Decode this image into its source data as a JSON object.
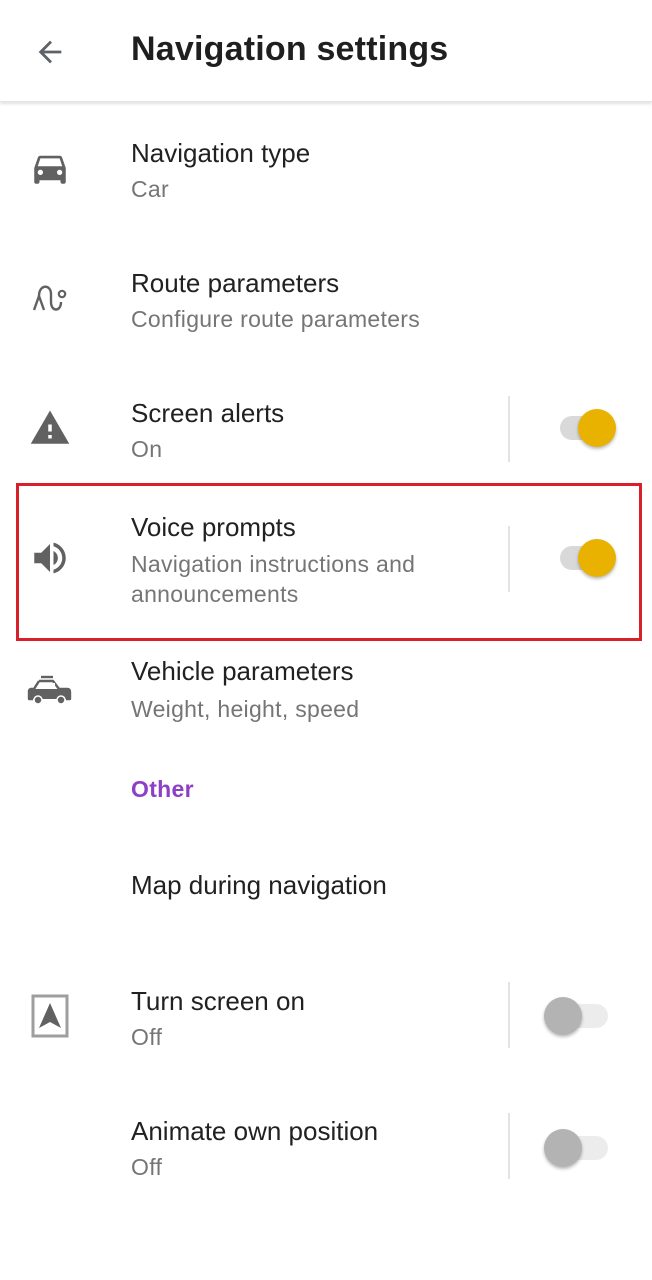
{
  "appbar": {
    "title": "Navigation settings",
    "back_icon": "arrow-back-icon"
  },
  "rows": [
    {
      "title": "Navigation type",
      "subtitle": "Car",
      "icon": "car-icon"
    },
    {
      "title": "Route parameters",
      "subtitle": "Configure route parameters",
      "icon": "route-icon"
    },
    {
      "title": "Screen alerts",
      "subtitle": "On",
      "icon": "warning-icon",
      "switch": true
    },
    {
      "title": "Voice prompts",
      "subtitle": "Navigation instructions and announcements",
      "icon": "speaker-icon",
      "switch": true,
      "highlighted": true
    },
    {
      "title": "Vehicle parameters",
      "subtitle": "Weight, height, speed",
      "icon": "vehicle-icon"
    }
  ],
  "section_other": "Other",
  "other_rows": [
    {
      "title": "Map during navigation"
    },
    {
      "title": "Turn screen on",
      "subtitle": "Off",
      "icon": "navigation-arrow-icon",
      "switch": false
    },
    {
      "title": "Animate own position",
      "subtitle": "Off",
      "switch": false
    }
  ],
  "colors": {
    "accent_switch": "#eab200",
    "section_header": "#8d3fc7",
    "highlight_border": "#d7202a"
  }
}
